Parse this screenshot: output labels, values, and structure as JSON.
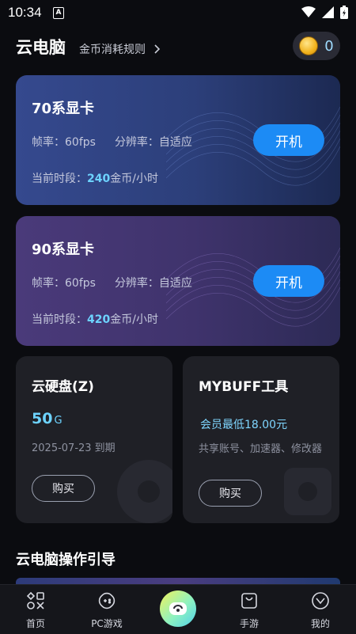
{
  "status_bar": {
    "time": "10:34",
    "a_icon": "A"
  },
  "header": {
    "title": "云电脑",
    "rules_link": "金币消耗规则",
    "coin_count": "0"
  },
  "gpu_cards": [
    {
      "name": "70系显卡",
      "fps": "帧率：60fps",
      "resolution": "分辨率：自适应",
      "price_prefix": "当前时段：",
      "price_amount": "240",
      "price_suffix": "金币/小时",
      "button": "开机"
    },
    {
      "name": "90系显卡",
      "fps": "帧率：60fps",
      "resolution": "分辨率：自适应",
      "price_prefix": "当前时段：",
      "price_amount": "420",
      "price_suffix": "金币/小时",
      "button": "开机"
    }
  ],
  "disk_card": {
    "title": "云硬盘(Z)",
    "size": "50",
    "unit": "G",
    "expiry": "2025-07-23 到期",
    "button": "购买"
  },
  "tool_card": {
    "title": "MYBUFF工具",
    "price": "会员最低18.00元",
    "desc": "共享账号、加速器、修改器",
    "button": "购买"
  },
  "guide": {
    "title": "云电脑操作引导"
  },
  "bottom_nav": [
    {
      "label": "首页",
      "icon": "home-grid-icon"
    },
    {
      "label": "PC游戏",
      "icon": "gamepad-icon"
    },
    {
      "label": "",
      "icon": "cloud-pc-icon"
    },
    {
      "label": "手游",
      "icon": "shopping-bag-icon"
    },
    {
      "label": "我的",
      "icon": "profile-icon"
    }
  ],
  "colors": {
    "accent": "#1c8bf5",
    "price_highlight": "#6dd3ff",
    "background": "#0b0c10"
  }
}
